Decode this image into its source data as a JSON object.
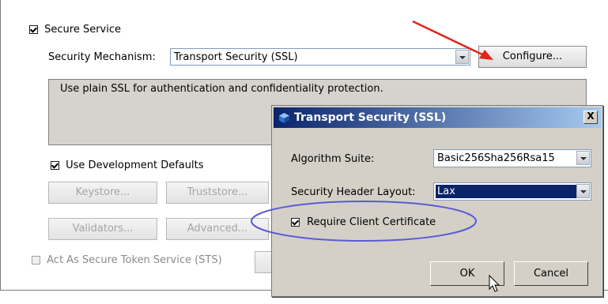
{
  "secure_service": {
    "label": "Secure Service",
    "checked": true
  },
  "mechanism": {
    "label": "Security Mechanism:",
    "value": "Transport Security (SSL)",
    "configure_label": "Configure..."
  },
  "description": "Use plain SSL for authentication and confidentiality protection.",
  "dev_defaults": {
    "label": "Use Development Defaults",
    "checked": true
  },
  "buttons": {
    "keystore": "Keystore...",
    "truststore": "Truststore...",
    "validators": "Validators...",
    "advanced": "Advanced..."
  },
  "sts": {
    "label": "Act As Secure Token Service (STS)",
    "checked": false
  },
  "dialog": {
    "title": "Transport Security (SSL)",
    "close_label": "X",
    "algorithm_label": "Algorithm Suite:",
    "algorithm_value": "Basic256Sha256Rsa15",
    "header_layout_label": "Security Header Layout:",
    "header_layout_value": "Lax",
    "require_cert": {
      "label": "Require Client Certificate",
      "checked": true
    },
    "ok_label": "OK",
    "cancel_label": "Cancel"
  },
  "colors": {
    "annotation_arrow": "#e2231a",
    "annotation_ellipse": "#5a5ad6",
    "title_gradient_start": "#0a246a",
    "selection": "#0a246a"
  }
}
